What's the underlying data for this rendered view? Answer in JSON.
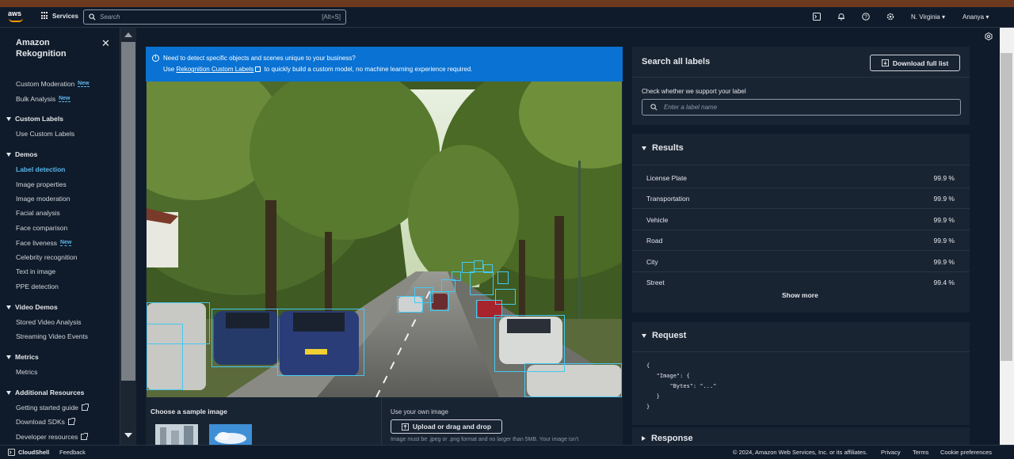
{
  "topnav": {
    "logo": "aws",
    "services": "Services",
    "search_placeholder": "Search",
    "search_shortcut": "[Alt+S]",
    "region": "N. Virginia",
    "user": "Ananya"
  },
  "sidebar": {
    "title_line1": "Amazon",
    "title_line2": "Rekognition",
    "new_badge": "New",
    "top_items": [
      {
        "label": "Custom Moderation",
        "new": true
      },
      {
        "label": "Bulk Analysis",
        "new": true
      }
    ],
    "sections": [
      {
        "title": "Custom Labels",
        "items": [
          "Use Custom Labels"
        ]
      },
      {
        "title": "Demos",
        "items": [
          "Label detection",
          "Image properties",
          "Image moderation",
          "Facial analysis",
          "Face comparison",
          "Face liveness",
          "Celebrity recognition",
          "Text in image",
          "PPE detection"
        ]
      },
      {
        "title": "Video Demos",
        "items": [
          "Stored Video Analysis",
          "Streaming Video Events"
        ]
      },
      {
        "title": "Metrics",
        "items": [
          "Metrics"
        ]
      },
      {
        "title": "Additional Resources",
        "items": [
          "Getting started guide",
          "Download SDKs",
          "Developer resources"
        ]
      }
    ]
  },
  "info": {
    "line1": "Need to detect specific objects and scenes unique to your business?",
    "line2_prefix": "Use",
    "link": "Rekognition Custom Labels",
    "line2_suffix": "to quickly build a custom model, no machine learning experience required."
  },
  "sample": {
    "title": "Choose a sample image",
    "own_title": "Use your own image",
    "upload_button": "Upload or drag and drop",
    "upload_hint": "Image must be .jpeg or .png format and no larger than 5MB. Your image isn't"
  },
  "labels_search": {
    "title": "Search all labels",
    "download_button": "Download full list",
    "check_label": "Check whether we support your label",
    "placeholder": "Enter a label name"
  },
  "results": {
    "title": "Results",
    "rows": [
      {
        "name": "License Plate",
        "value": "99.9 %"
      },
      {
        "name": "Transportation",
        "value": "99.9 %"
      },
      {
        "name": "Vehicle",
        "value": "99.9 %"
      },
      {
        "name": "Road",
        "value": "99.9 %"
      },
      {
        "name": "City",
        "value": "99.9 %"
      },
      {
        "name": "Street",
        "value": "99.4 %"
      }
    ],
    "show_more": "Show more"
  },
  "request": {
    "title": "Request",
    "code": "{\n   \"Image\": {\n       \"Bytes\": \"...\"\n   }\n}"
  },
  "response": {
    "title": "Response"
  },
  "footer": {
    "cloudshell": "CloudShell",
    "feedback": "Feedback",
    "copyright": "© 2024, Amazon Web Services, Inc. or its affiliates.",
    "privacy": "Privacy",
    "terms": "Terms",
    "cookie": "Cookie preferences"
  },
  "colors": {
    "accent": "#0972d3",
    "link": "#5ab5ec",
    "bbox": "#44c9f0",
    "brand_orange": "#ff9900"
  }
}
